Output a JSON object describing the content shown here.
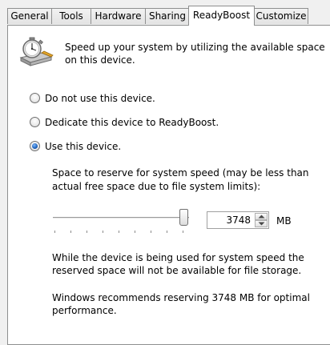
{
  "tabs": [
    {
      "label": "General",
      "active": false
    },
    {
      "label": "Tools",
      "active": false
    },
    {
      "label": "Hardware",
      "active": false
    },
    {
      "label": "Sharing",
      "active": false
    },
    {
      "label": "ReadyBoost",
      "active": true
    },
    {
      "label": "Customize",
      "active": false
    }
  ],
  "header": {
    "icon": "readyboost-stopwatch-icon",
    "line1": "Speed up your system by utilizing the available space",
    "line2": "on this device."
  },
  "options": {
    "no_use": {
      "label": "Do not use this device.",
      "checked": false
    },
    "dedicate": {
      "label": "Dedicate this device to ReadyBoost.",
      "checked": false
    },
    "use": {
      "label": "Use this device.",
      "checked": true
    }
  },
  "reserve": {
    "caption_line1": "Space to reserve for system speed (may be less than",
    "caption_line2": "actual free space due to file system limits):",
    "value": "3748",
    "unit": "MB",
    "slider_level_percent": 100
  },
  "notes": {
    "line1": "While the device is being used for system speed the",
    "line2": "reserved space will not be available for file storage.",
    "line3": "Windows recommends reserving 3748 MB for optimal",
    "line4": "performance."
  },
  "colors": {
    "panel": "#ffffff",
    "dialog": "#f0f0f0",
    "radio_selected": "#1b5fb8"
  }
}
